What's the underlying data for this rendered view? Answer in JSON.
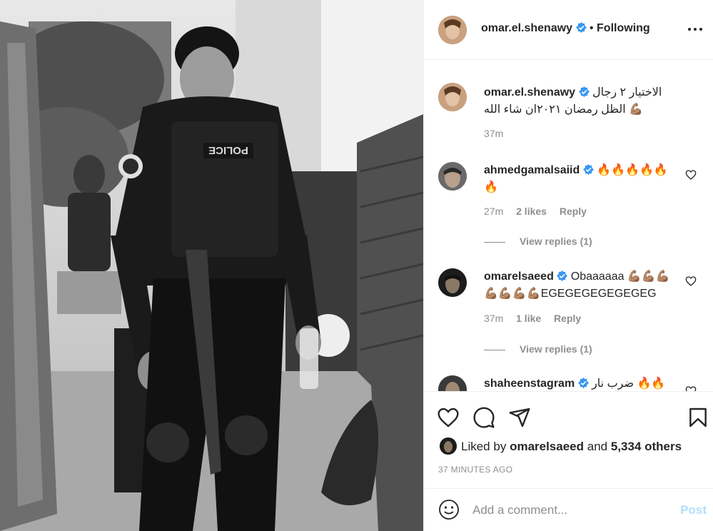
{
  "post": {
    "username": "omar.el.shenawy",
    "follow_separator": "•",
    "follow_status": "Following"
  },
  "caption": {
    "username": "omar.el.shenawy",
    "text": "الاختيار ٢ رجال الظل رمضان ٢٠٢١ان شاء الله 💪🏽",
    "time": "37m"
  },
  "comments": [
    {
      "username": "ahmedgamalsaiid",
      "text": "🔥🔥🔥🔥🔥🔥",
      "time": "27m",
      "likes": "2 likes",
      "reply": "Reply",
      "view_replies": "View replies (1)"
    },
    {
      "username": "omarelsaeed",
      "text": "Obaaaaaa 💪🏽💪🏽💪🏽💪🏽💪🏽💪🏽💪🏽EGEGEGEGEGEGEG",
      "time": "37m",
      "likes": "1 like",
      "reply": "Reply",
      "view_replies": "View replies (1)"
    },
    {
      "username": "shaheenstagram",
      "text": "ضرب نار 🔥🔥"
    }
  ],
  "likes": {
    "prefix": "Liked by",
    "user": "omarelsaeed",
    "conj": "and",
    "others": "5,334 others"
  },
  "timestamp": "37 MINUTES AGO",
  "add_comment": {
    "placeholder": "Add a comment...",
    "post_label": "Post"
  },
  "icons": {
    "more": "more-options-icon",
    "heart": "heart-icon",
    "comment": "comment-icon",
    "share": "share-icon",
    "save": "bookmark-icon",
    "emoji": "emoji-icon",
    "verified": "verified-badge-icon"
  },
  "colors": {
    "verified": "#3897f0",
    "post_disabled": "#b2dffc",
    "muted": "#8e8e8e"
  }
}
